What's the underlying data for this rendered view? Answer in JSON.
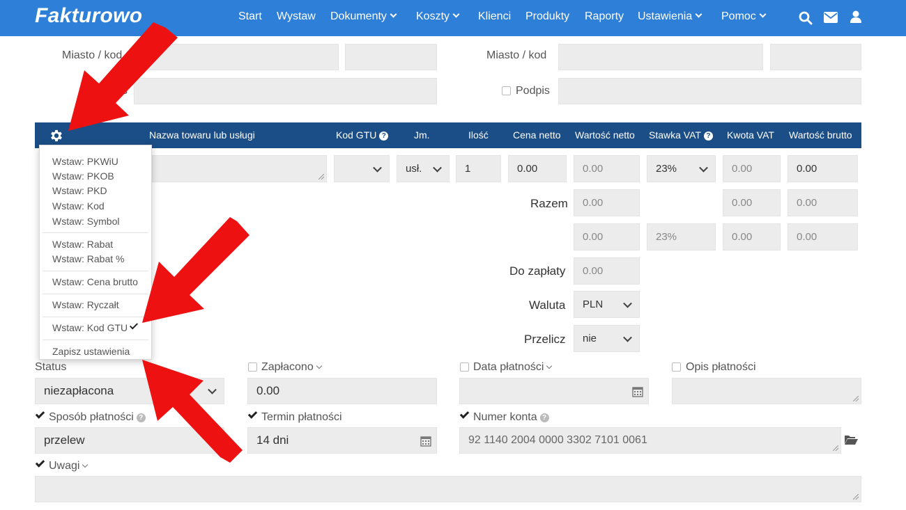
{
  "navbar": {
    "logo": "Fakturowo",
    "items": [
      {
        "label": "Start"
      },
      {
        "label": "Wystaw"
      },
      {
        "label": "Dokumenty"
      },
      {
        "label": "Koszty"
      },
      {
        "label": "Klienci"
      },
      {
        "label": "Produkty"
      },
      {
        "label": "Raporty"
      },
      {
        "label": "Ustawienia"
      },
      {
        "label": "Pomoc"
      }
    ],
    "icons": [
      "search-icon",
      "envelope-icon",
      "user-icon"
    ]
  },
  "parties": {
    "seller_city_label": "Miasto / kod",
    "seller_signature_label": "Podpis",
    "buyer_city_label": "Miasto / kod",
    "buyer_signature_label": "Podpis"
  },
  "table": {
    "headers": [
      "Nazwa towaru lub usługi",
      "Kod GTU",
      "Jm.",
      "Ilość",
      "Cena netto",
      "Wartość netto",
      "Stawka VAT",
      "Kwota VAT",
      "Wartość brutto"
    ],
    "row": {
      "unit": "usł.",
      "quantity": "1",
      "net_price": "0.00",
      "net_value": "0.00",
      "vat_rate": "23%",
      "vat_amount": "0.00",
      "gross_value": "0.00"
    },
    "summary": {
      "total_label": "Razem",
      "total_net": "0.00",
      "total_vat": "0.00",
      "total_gross": "0.00",
      "rate_net": "0.00",
      "rate_vat_rate": "23%",
      "rate_vat": "0.00",
      "rate_gross": "0.00",
      "to_pay_label": "Do zapłaty",
      "to_pay": "0.00",
      "currency_label": "Waluta",
      "currency": "PLN",
      "convert_label": "Przelicz",
      "convert": "nie"
    }
  },
  "settings_menu": {
    "items": [
      "Wstaw: PKWiU",
      "Wstaw: PKOB",
      "Wstaw: PKD",
      "Wstaw: Kod",
      "Wstaw: Symbol",
      "Wstaw: Rabat",
      "Wstaw: Rabat %",
      "Wstaw: Cena brutto",
      "Wstaw: Ryczałt",
      "Wstaw: Kod GTU",
      "Zapisz ustawienia"
    ]
  },
  "payment": {
    "status_label": "Status",
    "status_value": "niezapłacona",
    "paid_label": "Zapłacono",
    "paid_value": "0.00",
    "payment_date_label": "Data płatności",
    "payment_desc_label": "Opis płatności",
    "method_label": "Sposób płatności",
    "method_value": "przelew",
    "due_label": "Termin płatności",
    "due_value": "14 dni",
    "account_label": "Numer konta",
    "account_value": "92 1140 2004 0000 3302 7101 0061",
    "notes_label": "Uwagi"
  },
  "colors": {
    "navbar": "#2d7fd8",
    "table_header": "#1b4d86",
    "field_bg": "#ececec",
    "annotation_arrow": "#ee1111"
  }
}
